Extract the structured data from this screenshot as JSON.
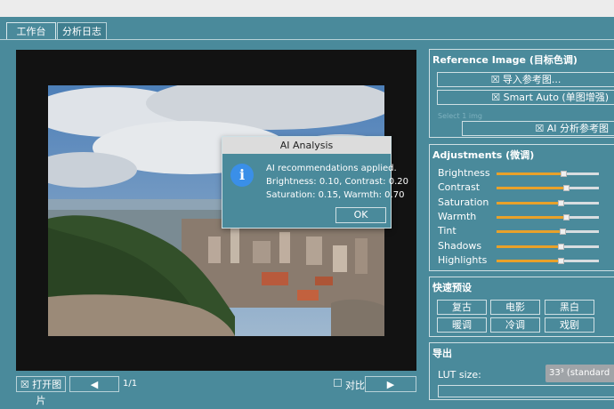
{
  "tabs": [
    {
      "label": "工作台",
      "active": true
    },
    {
      "label": "分析日志",
      "active": false
    }
  ],
  "bottom_bar": {
    "open_label": "☒ 打开图片",
    "prev_icon": "◀",
    "page_indicator": "1/1",
    "compare_label": "对比",
    "next_icon": "▶"
  },
  "dialog": {
    "title": "AI Analysis",
    "icon": "i",
    "line1": "AI recommendations applied.",
    "line2": "Brightness: 0.10, Contrast: 0.20",
    "line3": "Saturation: 0.15, Warmth: 0.70",
    "ok_label": "OK"
  },
  "reference": {
    "title": "Reference Image (目标色调)",
    "import_label": "☒ 导入参考图...",
    "smart_auto_label": "☒ Smart Auto (单图增强)",
    "placeholder": "Select 1 img",
    "ai_analyze_label": "☒ AI 分析参考图"
  },
  "adjustments": {
    "title": "Adjustments (微调)",
    "sliders": [
      {
        "label": "Brightness",
        "value": 0.65
      },
      {
        "label": "Contrast",
        "value": 0.68
      },
      {
        "label": "Saturation",
        "value": 0.63
      },
      {
        "label": "Warmth",
        "value": 0.68
      },
      {
        "label": "Tint",
        "value": 0.64
      },
      {
        "label": "Shadows",
        "value": 0.63
      },
      {
        "label": "Highlights",
        "value": 0.63
      }
    ]
  },
  "presets": {
    "title": "快速预设",
    "buttons": [
      "复古",
      "电影",
      "黑白",
      "暖调",
      "冷调",
      "戏剧"
    ]
  },
  "export": {
    "title": "导出",
    "lut_label": "LUT size:",
    "lut_value": "33³ (standard"
  },
  "colors": {
    "background": "#4a8a9b",
    "accent_track": "#e8a12a",
    "canvas": "#121212",
    "info_icon": "#3a8fe8"
  }
}
